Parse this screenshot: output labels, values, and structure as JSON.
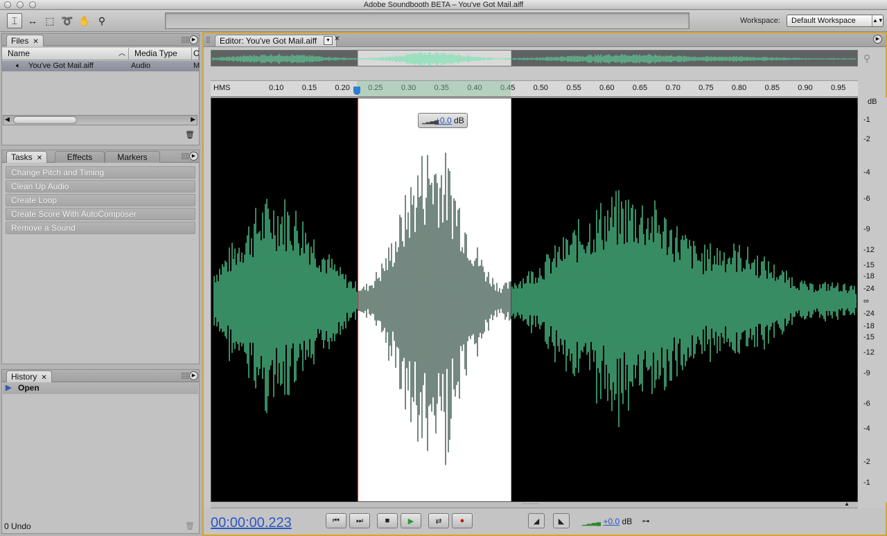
{
  "app": {
    "title": "Adobe Soundbooth BETA – You've Got Mail.aiff"
  },
  "toolbar": {
    "tools": [
      "time-selection-icon",
      "horizontal-selection-icon",
      "marquee-icon",
      "lasso-icon",
      "hand-icon",
      "zoom-icon"
    ],
    "workspace_label": "Workspace:",
    "workspace_value": "Default Workspace"
  },
  "files_panel": {
    "tab": "Files",
    "columns": [
      "Name",
      "Media Type",
      "C"
    ],
    "row": {
      "name": "You've Got Mail.aiff",
      "type": "Audio",
      "extra": "M"
    }
  },
  "tasks_panel": {
    "tabs": [
      "Tasks",
      "Effects",
      "Markers"
    ],
    "items": [
      "Change Pitch and Timing",
      "Clean Up Audio",
      "Create Loop",
      "Create Score With AutoComposer",
      "Remove a Sound"
    ]
  },
  "history_panel": {
    "tab": "History",
    "items": [
      "Open"
    ],
    "status": "0 Undo"
  },
  "editor": {
    "tab": "Editor: You've Got Mail.aiff",
    "ruler_unit": "HMS",
    "ruler_ticks": [
      "0.10",
      "0.15",
      "0.20",
      "0.25",
      "0.30",
      "0.35",
      "0.40",
      "0.45",
      "0.50",
      "0.55",
      "0.60",
      "0.65",
      "0.70",
      "0.75",
      "0.80",
      "0.85",
      "0.90",
      "0.95"
    ],
    "db_unit": "dB",
    "db_scale": [
      "-1",
      "-2",
      "-4",
      "-6",
      "-9",
      "-12",
      "-15",
      "-18",
      "-24",
      "∞",
      "-24",
      "-18",
      "-15",
      "-12",
      "-9",
      "-6",
      "-4",
      "-2",
      "-1"
    ],
    "gain_popup": {
      "value": "+0.0",
      "unit": "dB"
    },
    "selection_start": 0.223,
    "selection_end": 0.455
  },
  "transport": {
    "timecode": "00:00:00.223",
    "volume_value": "+0.0",
    "volume_unit": "dB"
  },
  "colors": {
    "accent": "#d9a32a",
    "waveform": "#5ee8a6",
    "selected_waveform": "#17392c",
    "timecode": "#2a56c6"
  }
}
